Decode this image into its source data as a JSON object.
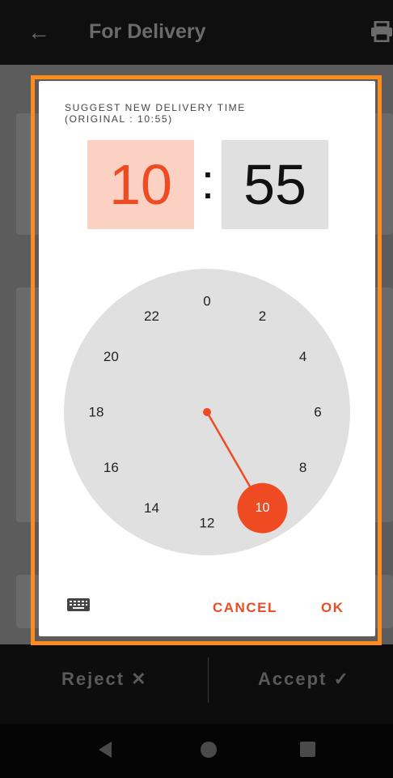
{
  "app_bar": {
    "title": "For Delivery",
    "back_icon": "arrow-left-icon",
    "print_icon": "printer-icon"
  },
  "bottom_actions": {
    "reject_label": "Reject ✕",
    "accept_label": "Accept ✓"
  },
  "system_nav": {
    "back": "nav-back-icon",
    "home": "nav-home-icon",
    "recents": "nav-recents-icon"
  },
  "dialog": {
    "header_line1": "SUGGEST NEW DELIVERY TIME",
    "header_line2": "(ORIGINAL : 10:55)",
    "hour": "10",
    "separator": ":",
    "minute": "55",
    "selected_hour": 10,
    "clock_labels": [
      "0",
      "2",
      "4",
      "6",
      "8",
      "10",
      "12",
      "14",
      "16",
      "18",
      "20",
      "22"
    ],
    "keyboard_icon": "keyboard-icon",
    "cancel_label": "CANCEL",
    "ok_label": "OK",
    "accent_color": "#ee4b22",
    "highlight_color": "#ff8c1a"
  }
}
